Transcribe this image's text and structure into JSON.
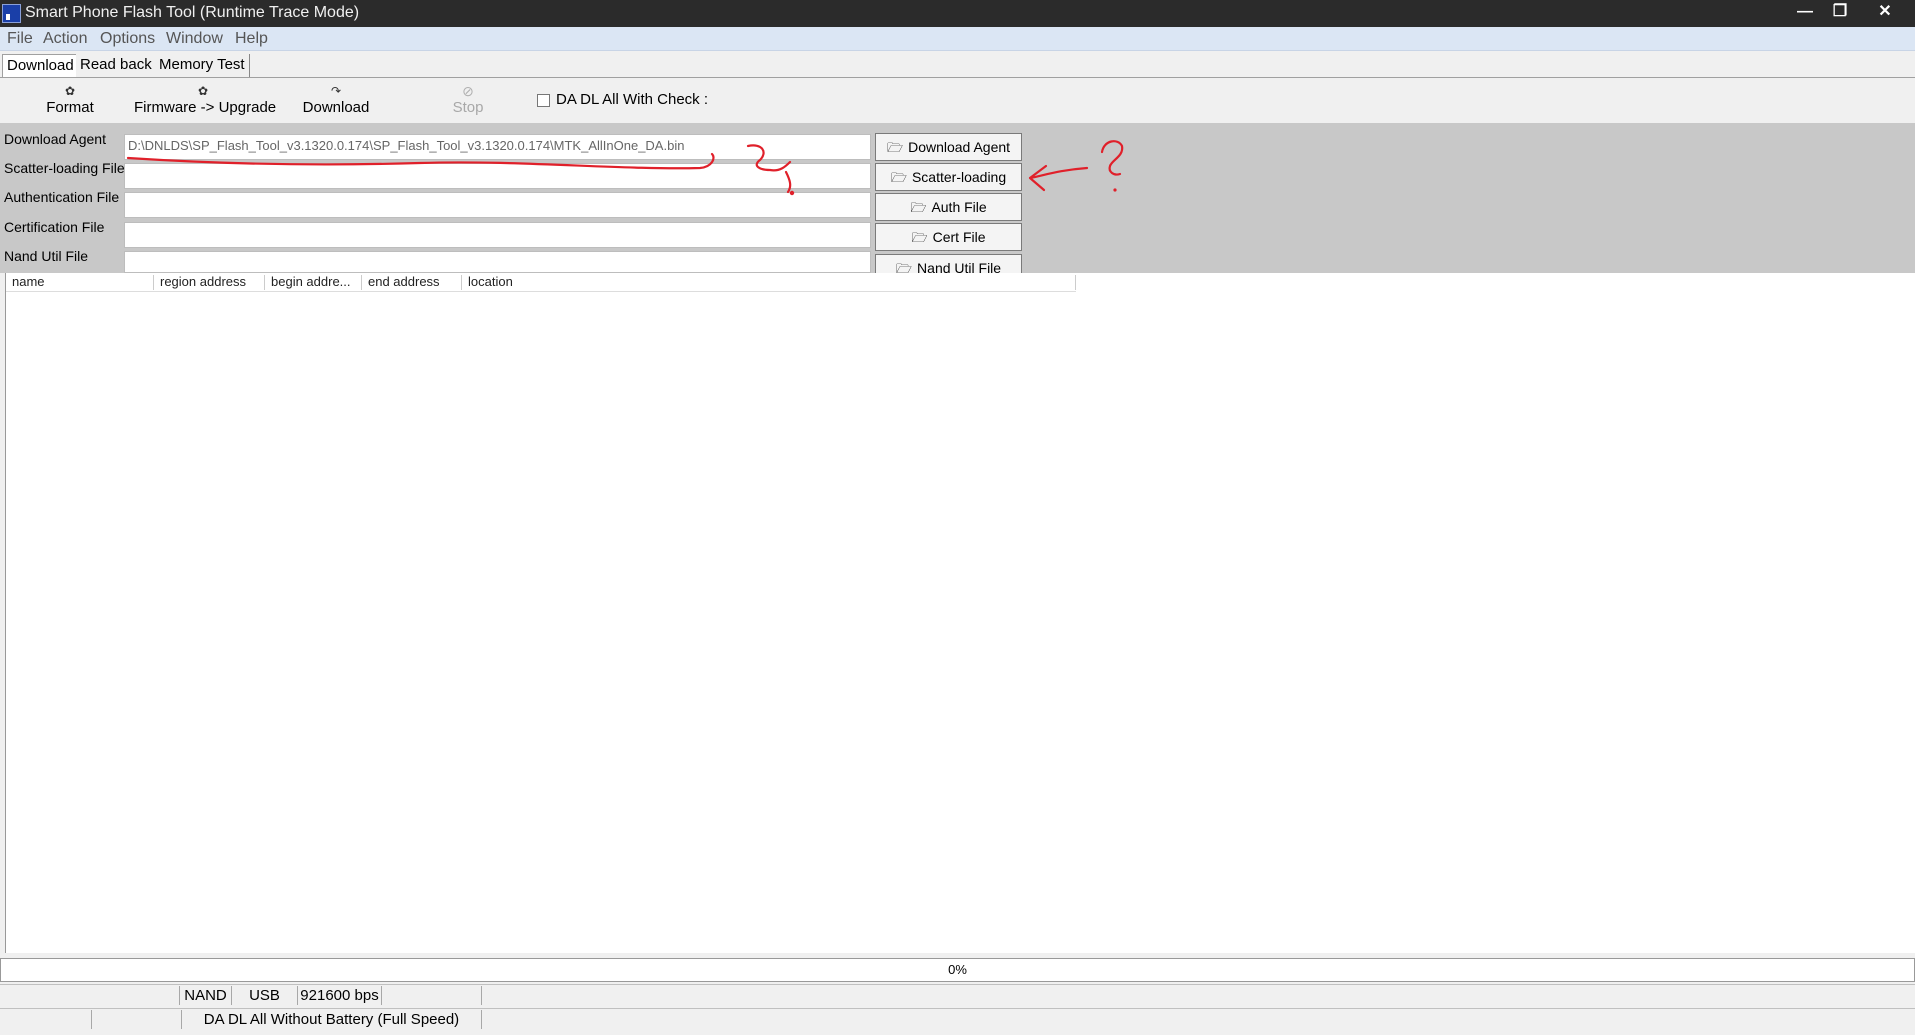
{
  "window": {
    "title": "Smart Phone Flash Tool (Runtime Trace Mode)",
    "controls": {
      "minimize": "—",
      "maximize": "❐",
      "close": "✕"
    }
  },
  "menu": [
    "File",
    "Action",
    "Options",
    "Window",
    "Help"
  ],
  "tabs": [
    {
      "label": "Download",
      "active": true
    },
    {
      "label": "Read back",
      "active": false
    },
    {
      "label": "Memory Test",
      "active": false
    }
  ],
  "toolbar": {
    "format": {
      "label": "Format",
      "icon": "format-icon"
    },
    "firmware_upgrade": {
      "label": "Firmware -> Upgrade",
      "icon": "firmware-upgrade-icon"
    },
    "download": {
      "label": "Download",
      "icon": "download-icon"
    },
    "stop": {
      "label": "Stop",
      "icon": "stop-icon",
      "enabled": false
    },
    "da_check": {
      "label": "DA DL All With Check :",
      "checked": false
    }
  },
  "files": {
    "download_agent": {
      "label": "Download Agent",
      "value": "D:\\DNLDS\\SP_Flash_Tool_v3.1320.0.174\\SP_Flash_Tool_v3.1320.0.174\\MTK_AllInOne_DA.bin",
      "button": "Download Agent"
    },
    "scatter": {
      "label": "Scatter-loading File",
      "value": "",
      "button": "Scatter-loading"
    },
    "auth": {
      "label": "Authentication File",
      "value": "",
      "button": "Auth File"
    },
    "cert": {
      "label": "Certification File",
      "value": "",
      "button": "Cert File"
    },
    "nand": {
      "label": "Nand Util File",
      "value": "",
      "button": "Nand Util File"
    }
  },
  "table": {
    "columns": [
      "name",
      "region address",
      "begin addre...",
      "end address",
      "location"
    ],
    "rows": []
  },
  "progress": {
    "percent_text": "0%",
    "fraction": 0
  },
  "status": {
    "row1": {
      "storage": "NAND",
      "connection": "USB",
      "baud": "921600 bps"
    },
    "row2": {
      "mode": "DA DL All Without Battery (Full Speed)"
    }
  },
  "colors": {
    "annotation": "#e0202a",
    "panel": "#c8c8c8",
    "menubar": "#dbe6f4"
  }
}
